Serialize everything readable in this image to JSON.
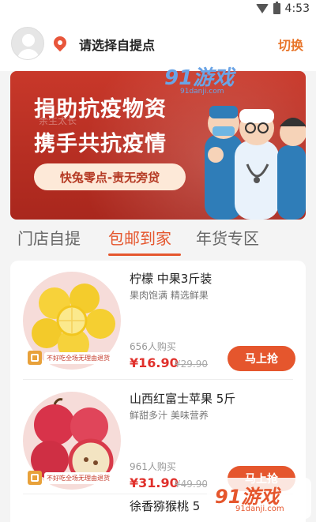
{
  "status_bar": {
    "time": "4:53"
  },
  "header": {
    "pickup_label": "请选择自提点",
    "switch_label": "切换"
  },
  "banner": {
    "line1": "捐助抗疫物资",
    "line2": "携手共抗疫情",
    "tagline": "快兔零点-责无旁贷",
    "faint_text": "余生太长"
  },
  "watermark_top": {
    "logo": "91游戏",
    "site": "91danji.com"
  },
  "tabs": [
    {
      "label": "门店自提"
    },
    {
      "label": "包邮到家"
    },
    {
      "label": "年货专区"
    }
  ],
  "active_tab": "包邮到家",
  "products": [
    {
      "name": "柠檬 中果3斤装",
      "desc": "果肉饱满 精选鲜果",
      "sold": "656人购买",
      "price": "¥16.90",
      "orig_price": "¥29.90",
      "buy_label": "马上抢",
      "badge_text": "不好吃全场无理由退货"
    },
    {
      "name": "山西红富士苹果  5斤",
      "desc": "鲜甜多汁 美味营养",
      "sold": "961人购买",
      "price": "¥31.90",
      "orig_price": "¥49.90",
      "buy_label": "马上抢",
      "badge_text": "不好吃全场无理由退货"
    },
    {
      "name": "徐香猕猴桃 5"
    }
  ],
  "watermark_bottom": {
    "logo": "91游戏",
    "site": "91danji.com"
  },
  "colors": {
    "accent": "#e5562d",
    "price": "#e0302b",
    "banner": "#c8382a"
  },
  "icons": [
    "wifi-icon",
    "battery-icon",
    "avatar-icon",
    "location-pin-icon",
    "guarantee-icon"
  ]
}
